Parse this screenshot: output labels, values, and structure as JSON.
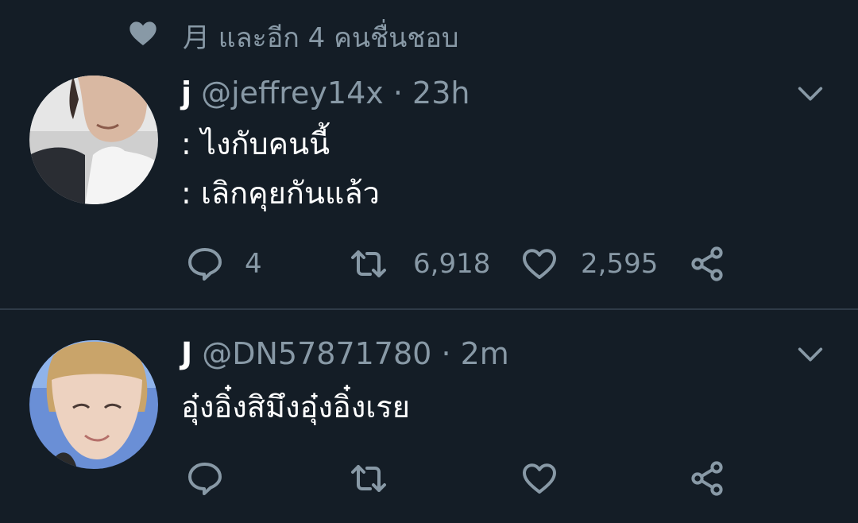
{
  "social_context": {
    "icon": "heart-icon",
    "text": "月 และอีก 4 คนชื่นชอบ"
  },
  "tweets": [
    {
      "avatar": "avatar-photo",
      "display_name": "j",
      "handle": "@jeffrey14x",
      "separator": "·",
      "time": "23h",
      "lines": [
        ": ไงกับคนนี้",
        ": เลิกคุยกันแล้ว"
      ],
      "actions": {
        "reply_count": "4",
        "retweet_count": "6,918",
        "like_count": "2,595"
      }
    },
    {
      "avatar": "avatar-photo",
      "display_name": "J",
      "handle": "@DN57871780",
      "separator": "·",
      "time": "2m",
      "lines": [
        "อุ๋งอิ๋งสิมึงอุ๋งอิ๋งเรย"
      ],
      "actions": {
        "reply_count": "",
        "retweet_count": "",
        "like_count": ""
      }
    }
  ],
  "colors": {
    "background": "#141d26",
    "text_primary": "#ffffff",
    "text_secondary": "#8899a6",
    "divider": "#2f3b47"
  }
}
